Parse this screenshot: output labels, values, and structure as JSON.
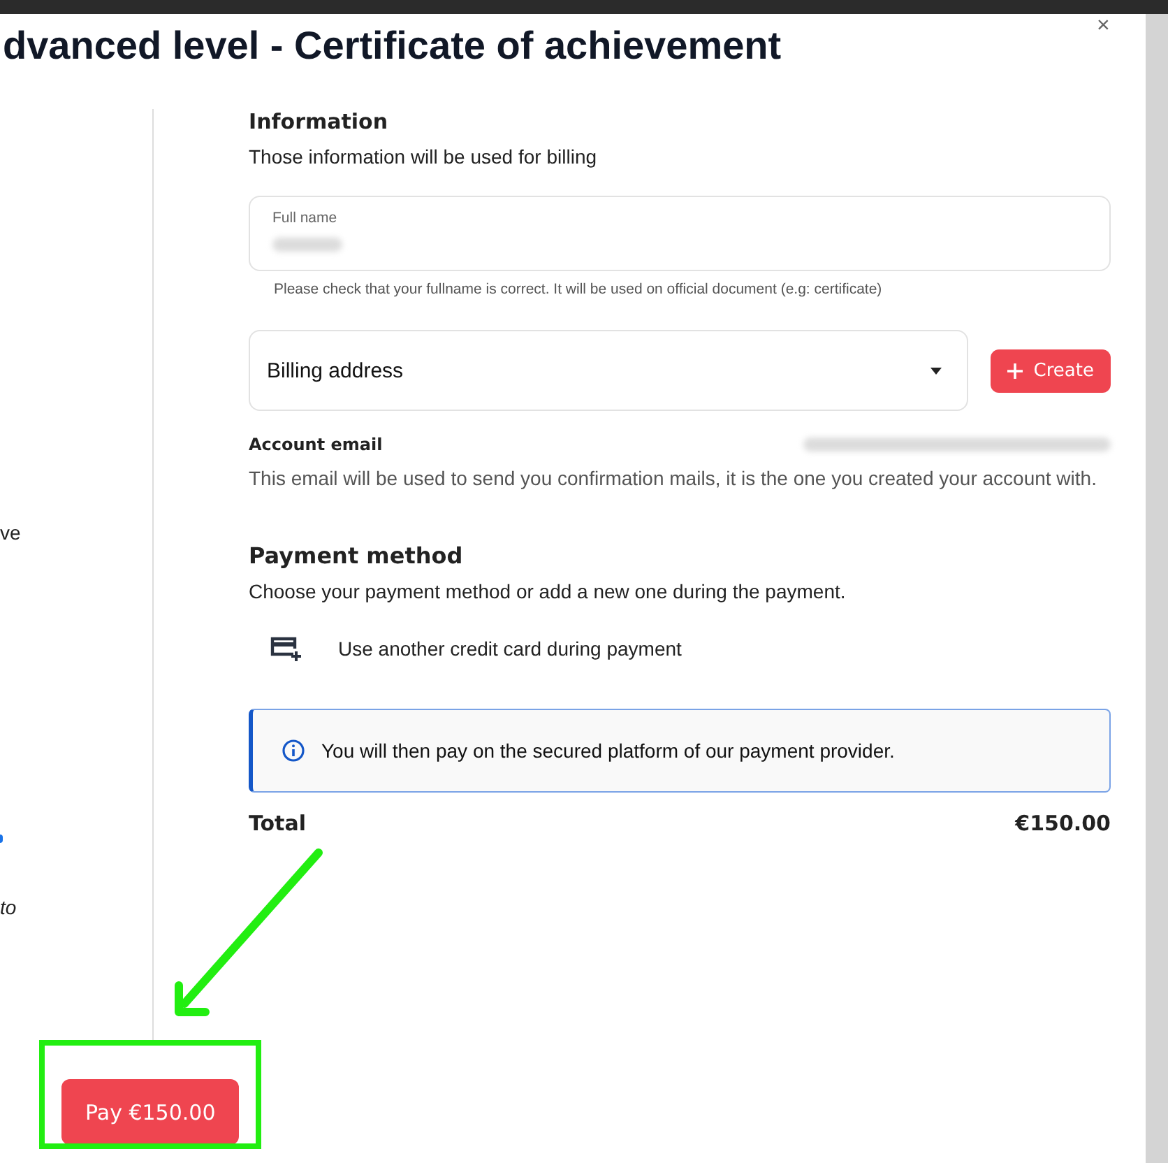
{
  "title": "dvanced level - Certificate of achievement",
  "close": "×",
  "side_fragments": [
    {
      "kind": "plain",
      "text": "ve"
    },
    {
      "kind": "dot"
    },
    {
      "kind": "italic",
      "text": "to"
    }
  ],
  "information": {
    "heading": "Information",
    "subtitle": "Those information will be used for billing",
    "full_name": {
      "label": "Full name",
      "hint": "Please check that your fullname is correct. It will be used on official document (e.g: certificate)"
    },
    "billing_address": {
      "placeholder": "Billing address"
    },
    "create_button": "Create",
    "account_email": {
      "label": "Account email",
      "description": "This email will be used to send you confirmation mails, it is the one you created your account with."
    }
  },
  "payment": {
    "heading": "Payment method",
    "subtitle": "Choose your payment method or add a new one during the payment.",
    "option": "Use another credit card during payment",
    "notice": "You will then pay on the secured platform of our payment provider."
  },
  "total": {
    "label": "Total",
    "amount": "€150.00"
  },
  "pay_button": "Pay €150.00"
}
